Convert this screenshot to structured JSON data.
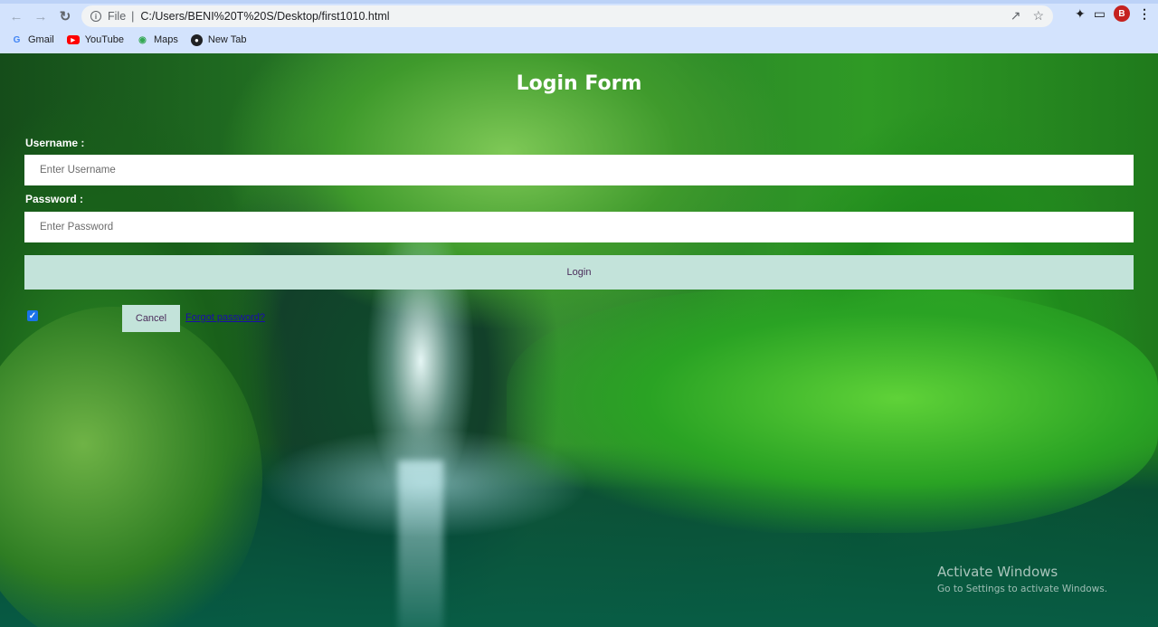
{
  "browser": {
    "back_icon": "arrow-left-icon",
    "forward_icon": "arrow-right-icon",
    "reload_icon": "reload-icon",
    "scheme": "File",
    "url": "C:/Users/BENI%20T%20S/Desktop/first1010.html",
    "avatar_letter": "B",
    "bookmarks": [
      {
        "label": "Gmail",
        "icon": "gmail-icon"
      },
      {
        "label": "YouTube",
        "icon": "youtube-icon"
      },
      {
        "label": "Maps",
        "icon": "maps-icon"
      },
      {
        "label": "New Tab",
        "icon": "globe-icon"
      }
    ]
  },
  "form": {
    "title": "Login Form",
    "username_label": "Username :",
    "username_placeholder": "Enter Username",
    "password_label": "Password :",
    "password_placeholder": "Enter Password",
    "login_label": "Login",
    "remember_checked": true,
    "cancel_label": "Cancel",
    "forgot_label": "Forgot password?"
  },
  "watermark": {
    "title": "Activate Windows",
    "subtitle": "Go to Settings to activate Windows."
  },
  "colors": {
    "button_bg": "#c3e3da",
    "button_text": "#4a2b5a",
    "chrome_bg": "#d3e3fd",
    "avatar_bg": "#c5221f"
  }
}
